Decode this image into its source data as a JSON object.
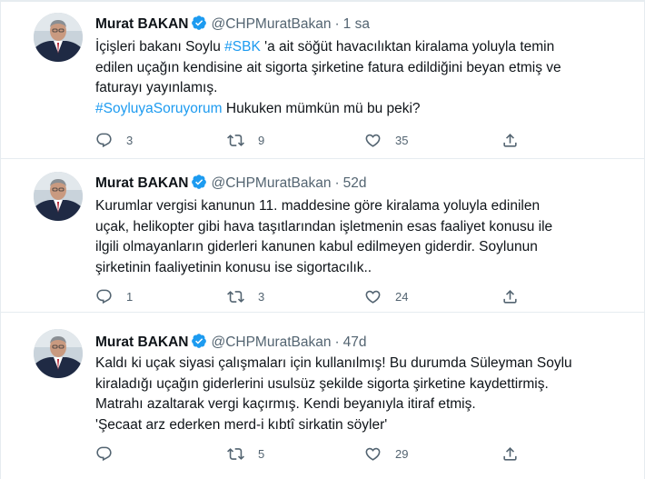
{
  "accent_color": "#1d9bf0",
  "tweets": [
    {
      "author": "Murat BAKAN",
      "handle": "@CHPMuratBakan",
      "time": "1 sa",
      "verified": true,
      "lines": [
        {
          "a": "İçişleri bakanı Soylu ",
          "h": "#SBK",
          "b": " 'a ait söğüt havacılıktan kiralama yoluyla temin"
        },
        {
          "a": "edilen uçağın kendisine ait sigorta şirketine fatura edildiğini beyan etmiş ve",
          "h": "",
          "b": ""
        },
        {
          "a": "faturayı yayınlamış.",
          "h": "",
          "b": ""
        },
        {
          "a": "",
          "h": "#SoyluyaSoruyorum",
          "b": " Hukuken mümkün mü bu peki?"
        }
      ],
      "reply_count": "3",
      "retweet_count": "9",
      "like_count": "35"
    },
    {
      "author": "Murat BAKAN",
      "handle": "@CHPMuratBakan",
      "time": "52d",
      "verified": true,
      "lines": [
        {
          "a": "Kurumlar vergisi kanunun 11. maddesine göre kiralama yoluyla edinilen",
          "h": "",
          "b": ""
        },
        {
          "a": "uçak, helikopter gibi hava taşıtlarından işletmenin esas faaliyet konusu ile",
          "h": "",
          "b": ""
        },
        {
          "a": "ilgili olmayanların giderleri kanunen kabul edilmeyen giderdir. Soylunun",
          "h": "",
          "b": ""
        },
        {
          "a": "şirketinin faaliyetinin konusu ise sigortacılık..",
          "h": "",
          "b": ""
        }
      ],
      "reply_count": "1",
      "retweet_count": "3",
      "like_count": "24"
    },
    {
      "author": "Murat BAKAN",
      "handle": "@CHPMuratBakan",
      "time": "47d",
      "verified": true,
      "lines": [
        {
          "a": "Kaldı ki uçak siyasi çalışmaları için kullanılmış! Bu durumda Süleyman Soylu",
          "h": "",
          "b": ""
        },
        {
          "a": "kiraladığı uçağın giderlerini usulsüz şekilde sigorta şirketine kaydettirmiş.",
          "h": "",
          "b": ""
        },
        {
          "a": "Matrahı azaltarak vergi kaçırmış. Kendi beyanıyla itiraf etmiş.",
          "h": "",
          "b": ""
        },
        {
          "a": "'Şecaat arz ederken merd-i kıbtî sirkatin söyler'",
          "h": "",
          "b": ""
        }
      ],
      "reply_count": "",
      "retweet_count": "5",
      "like_count": "29"
    }
  ]
}
